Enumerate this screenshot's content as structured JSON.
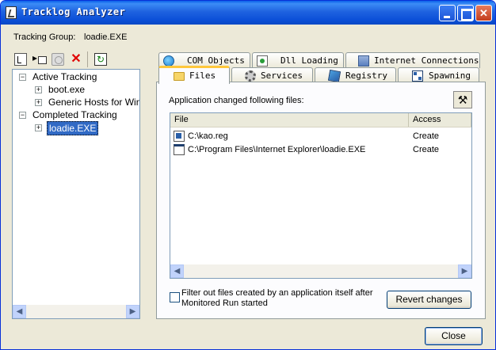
{
  "window": {
    "title": "Tracklog Analyzer"
  },
  "group": {
    "label": "Tracking Group:",
    "value": "loadie.EXE"
  },
  "toolbar": {
    "icons": [
      "tree-view-icon",
      "run-icon",
      "stop-icon",
      "delete-icon",
      "refresh-icon"
    ],
    "delete_color": "#e00000"
  },
  "tree": {
    "nodes": [
      {
        "label": "Active Tracking",
        "expander": "−"
      },
      {
        "label": "boot.exe",
        "expander": "+"
      },
      {
        "label": "Generic Hosts for WinSe",
        "expander": "+"
      },
      {
        "label": "Completed Tracking",
        "expander": "−"
      },
      {
        "label": "loadie.EXE",
        "expander": "+",
        "selected": true
      }
    ]
  },
  "tabs": {
    "row1": [
      "COM Objects",
      "Dll Loading",
      "Internet Connections"
    ],
    "row2": [
      "Files",
      "Services",
      "Registry",
      "Spawning"
    ],
    "active": "Files"
  },
  "files_panel": {
    "caption": "Application changed following files:",
    "columns": {
      "file": "File",
      "access": "Access"
    },
    "rows": [
      {
        "file": "C:\\kao.reg",
        "access": "Create",
        "icon": "reg-file-icon"
      },
      {
        "file": "C:\\Program Files\\Internet Explorer\\loadie.EXE",
        "access": "Create",
        "icon": "exe-file-icon"
      }
    ],
    "filter_label": "Filter out files created by an application itself after Monitored Run started",
    "revert_button": "Revert changes"
  },
  "footer": {
    "close_button": "Close"
  },
  "colors": {
    "title_bar": "#0b4fd8",
    "selection": "#316ac5",
    "active_tab_accent": "#ffc83c"
  }
}
